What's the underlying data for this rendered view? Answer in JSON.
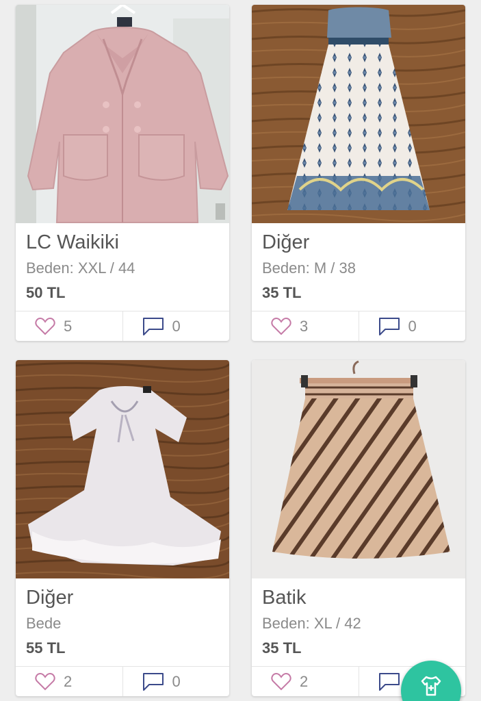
{
  "listings": [
    {
      "brand": "LC Waikiki",
      "size": "Beden: XXL / 44",
      "price": "50 TL",
      "likes": "5",
      "comments": "0",
      "photo": "pink-coat-photo"
    },
    {
      "brand": "Diğer",
      "size": "Beden: M / 38",
      "price": "35 TL",
      "likes": "3",
      "comments": "0",
      "photo": "patterned-dress-photo"
    },
    {
      "brand": "Diğer",
      "size": "Bede",
      "price": "55 TL",
      "likes": "2",
      "comments": "0",
      "photo": "white-dress-photo"
    },
    {
      "brand": "Batik",
      "size": "Beden: XL / 42",
      "price": "35 TL",
      "likes": "2",
      "comments": "",
      "photo": "striped-skirt-photo"
    }
  ],
  "icons": {
    "like": "heart-icon",
    "comment": "comment-icon",
    "fab": "add-clothing-icon"
  },
  "colors": {
    "like": "#c57aa6",
    "comment": "#3b4a8a",
    "fab": "#2ec4a0"
  }
}
